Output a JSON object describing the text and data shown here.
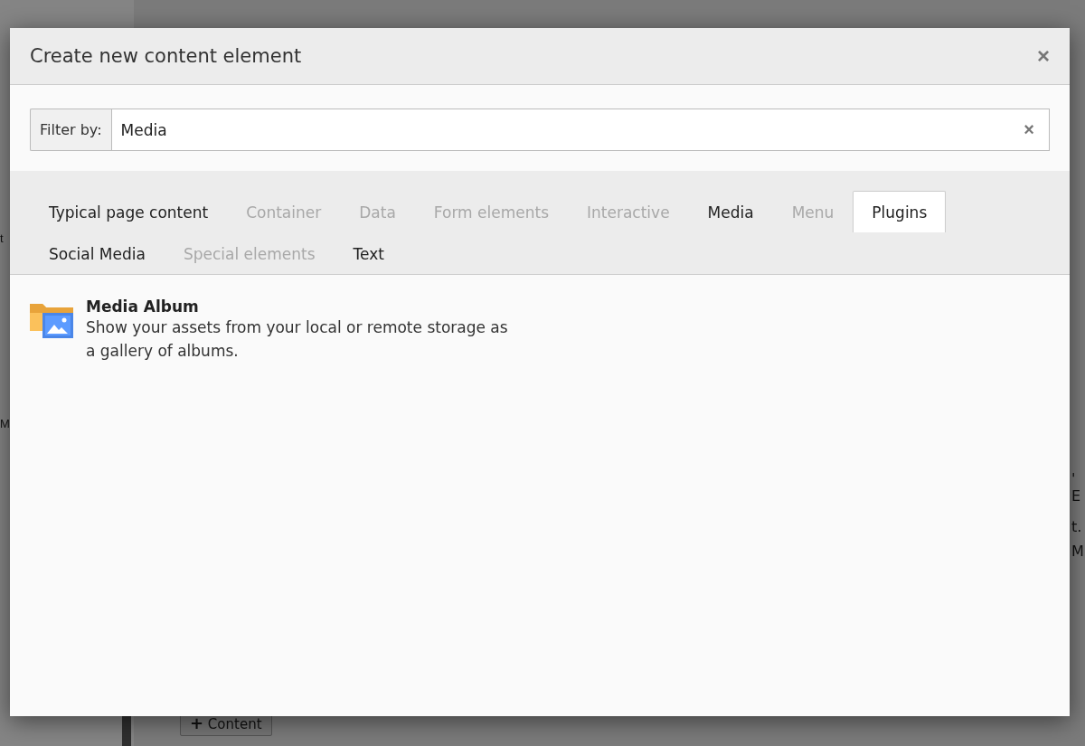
{
  "background": {
    "left_fragments": [
      "t",
      "M"
    ],
    "right_fragments": [
      "' E",
      "t.",
      "M"
    ],
    "add_button": {
      "icon": "+",
      "label": "Content"
    }
  },
  "dialog": {
    "title": "Create new content element",
    "close": "×",
    "filter": {
      "label": "Filter by:",
      "value": "Media",
      "clear": "×"
    },
    "tabs": [
      {
        "label": "Typical page content",
        "selected": false,
        "disabled": false
      },
      {
        "label": "Container",
        "selected": false,
        "disabled": true
      },
      {
        "label": "Data",
        "selected": false,
        "disabled": true
      },
      {
        "label": "Form elements",
        "selected": false,
        "disabled": true
      },
      {
        "label": "Interactive",
        "selected": false,
        "disabled": true
      },
      {
        "label": "Media",
        "selected": false,
        "disabled": false
      },
      {
        "label": "Menu",
        "selected": false,
        "disabled": true
      },
      {
        "label": "Plugins",
        "selected": true,
        "disabled": false
      },
      {
        "label": "Social Media",
        "selected": false,
        "disabled": false
      },
      {
        "label": "Special elements",
        "selected": false,
        "disabled": true
      },
      {
        "label": "Text",
        "selected": false,
        "disabled": false
      }
    ],
    "elements": [
      {
        "title": "Media Album",
        "description": "Show your assets from your local or remote storage as a gallery of albums."
      }
    ]
  }
}
